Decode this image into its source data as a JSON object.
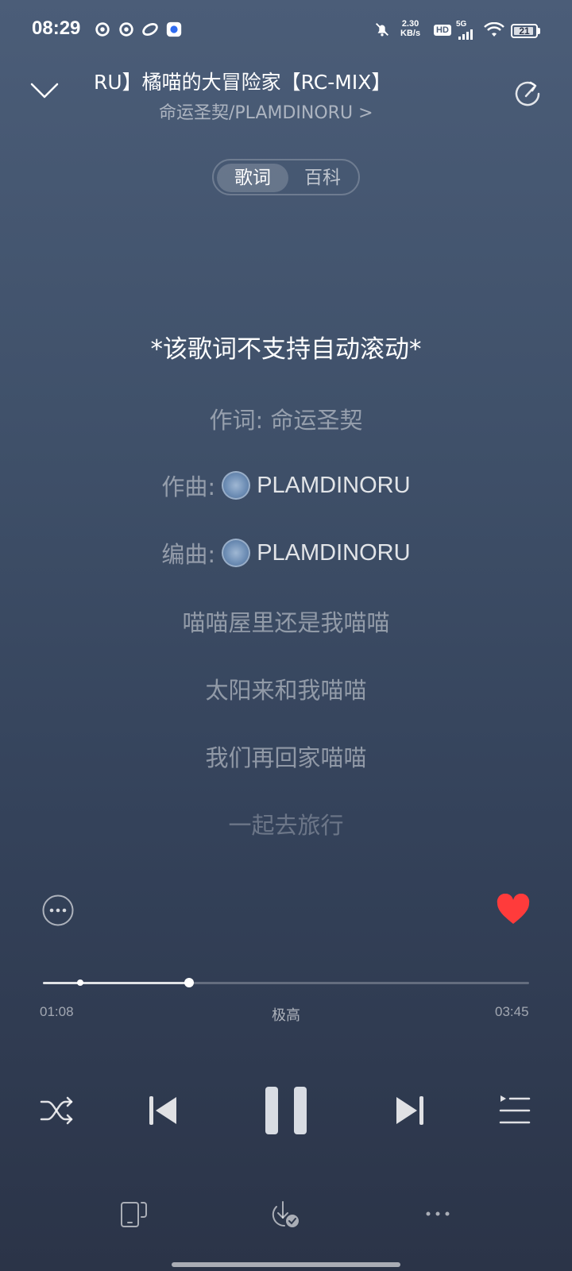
{
  "status_bar": {
    "time": "08:29",
    "net_speed_value": "2.30",
    "net_speed_unit": "KB/s",
    "hd_label": "HD",
    "signal_label": "5G",
    "battery": "21"
  },
  "header": {
    "title": "RU】橘喵的大冒险家【RC-MIX】",
    "artist": "命运圣契/PLAMDINORU",
    "artist_chevron": ">"
  },
  "tabs": [
    {
      "label": "歌词",
      "active": true
    },
    {
      "label": "百科",
      "active": false
    }
  ],
  "lyrics": {
    "notice": "*该歌词不支持自动滚动*",
    "lyricist": "作词: 命运圣契",
    "composer_label": "作曲:",
    "composer_name": "PLAMDINORU",
    "arranger_label": "编曲:",
    "arranger_name": "PLAMDINORU",
    "lines": [
      "喵喵屋里还是我喵喵",
      "太阳来和我喵喵",
      "我们再回家喵喵",
      "一起去旅行"
    ]
  },
  "player": {
    "current_time": "01:08",
    "total_time": "03:45",
    "quality": "极高",
    "progress_fraction": 0.3,
    "liked": true
  },
  "colors": {
    "like": "#ff3b3b",
    "background_top": "#4b5d78",
    "background_bottom": "#2b3448"
  },
  "icons": {
    "collapse": "chevron-down-icon",
    "share": "share-rotate-icon",
    "more": "more-circle-icon",
    "like": "heart-icon",
    "shuffle": "shuffle-icon",
    "previous": "previous-icon",
    "pause": "pause-icon",
    "next": "next-icon",
    "playlist": "playlist-icon",
    "device": "device-icon",
    "download": "download-icon",
    "more_horizontal": "more-horizontal-icon"
  }
}
